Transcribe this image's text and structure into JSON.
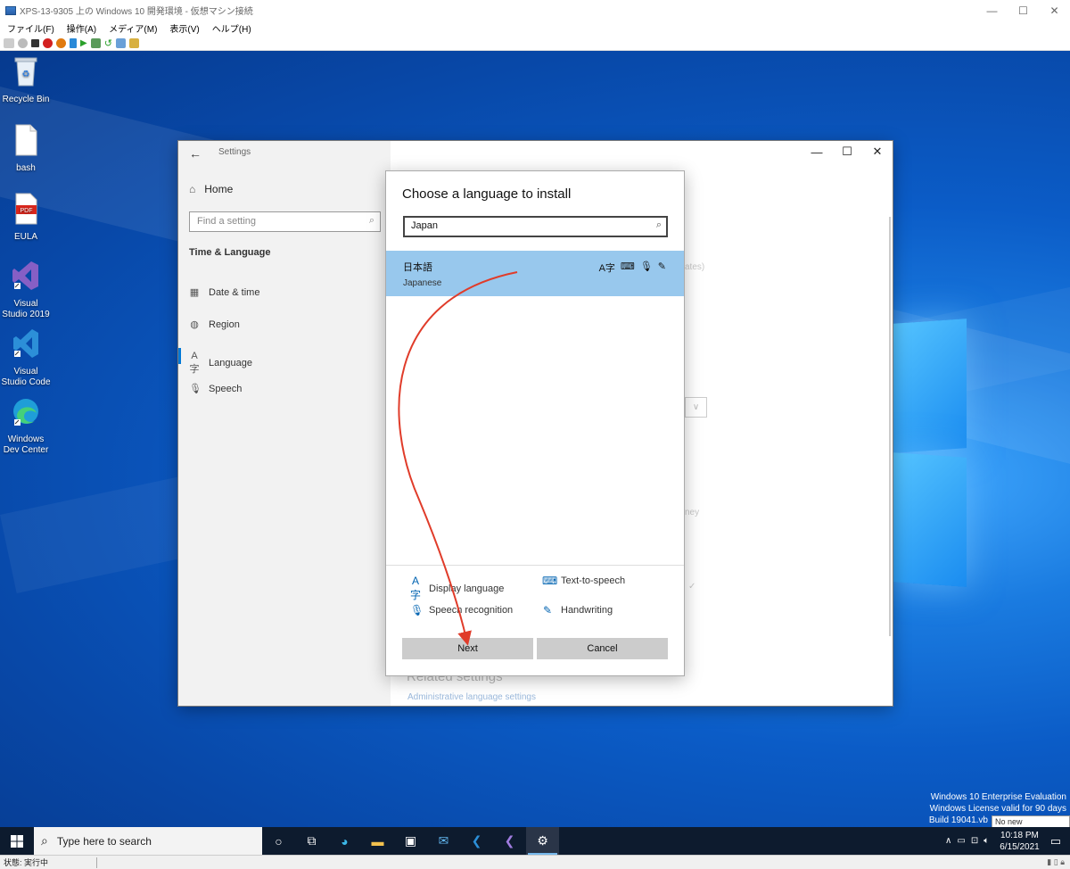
{
  "host": {
    "title": "XPS-13-9305 上の Windows 10 開発環境 - 仮想マシン接続",
    "menus": [
      "ファイル(F)",
      "操作(A)",
      "メディア(M)",
      "表示(V)",
      "ヘルプ(H)"
    ],
    "status": "状態: 実行中"
  },
  "desktop_icons": [
    {
      "label": "Recycle Bin",
      "icon": "recycle-bin-icon"
    },
    {
      "label": "bash",
      "icon": "file-icon"
    },
    {
      "label": "EULA",
      "icon": "pdf-icon"
    },
    {
      "label": "Visual Studio 2019",
      "icon": "visual-studio-icon"
    },
    {
      "label": "Visual Studio Code",
      "icon": "vscode-icon"
    },
    {
      "label": "Windows Dev Center",
      "icon": "edge-icon"
    }
  ],
  "pdf_badge": "PDF",
  "settings": {
    "window_title": "Settings",
    "home": "Home",
    "search_placeholder": "Find a setting",
    "section": "Time & Language",
    "nav_items": [
      {
        "label": "Date & time",
        "icon": "calendar-icon"
      },
      {
        "label": "Region",
        "icon": "globe-icon"
      },
      {
        "label": "Language",
        "icon": "language-icon",
        "selected": true
      },
      {
        "label": "Speech",
        "icon": "microphone-icon"
      }
    ],
    "background_fragments": {
      "updates": "ates)",
      "money": "ney"
    },
    "related_title": "Related settings",
    "related_link": "Administrative language settings"
  },
  "dialog": {
    "title": "Choose a language to install",
    "search_value": "Japan",
    "result": {
      "native": "日本語",
      "english": "Japanese"
    },
    "features": [
      {
        "label": "Display language",
        "icon": "display-language-icon"
      },
      {
        "label": "Text-to-speech",
        "icon": "text-to-speech-icon"
      },
      {
        "label": "Speech recognition",
        "icon": "speech-recognition-icon"
      },
      {
        "label": "Handwriting",
        "icon": "handwriting-icon"
      }
    ],
    "next_label": "Next",
    "cancel_label": "Cancel"
  },
  "watermark": {
    "line1": "Windows 10 Enterprise Evaluation",
    "line2": "Windows License valid for 90 days",
    "line3": "Build 19041.vb",
    "toast": "No new notifications"
  },
  "taskbar": {
    "search_placeholder": "Type here to search",
    "time": "10:18 PM",
    "date": "6/15/2021"
  },
  "colors": {
    "accent": "#0078d7",
    "selection": "#98c8ed",
    "arrow": "#e03c2a"
  }
}
